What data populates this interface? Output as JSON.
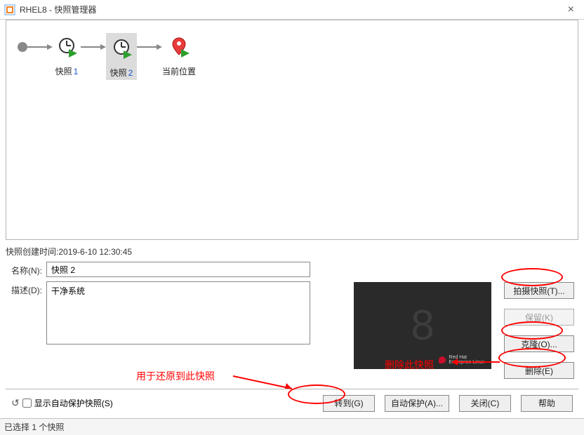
{
  "window": {
    "title": "RHEL8 - 快照管理器"
  },
  "tree": {
    "snap1_label": "快照",
    "snap1_num": "1",
    "snap2_label": "快照",
    "snap2_num": "2",
    "current_label": "当前位置"
  },
  "details": {
    "created_label": "快照创建时间:",
    "created_value": "2019-6-10 12:30:45",
    "name_label": "名称(N):",
    "name_value": "快照 2",
    "desc_label": "描述(D):",
    "desc_value": "干净系统"
  },
  "preview": {
    "glyph": "8",
    "brand_top": "Red Hat",
    "brand_bot": "Enterprise Linux"
  },
  "side": {
    "take": "拍摄快照(T)...",
    "keep": "保留(K)",
    "clone": "克隆(O)...",
    "delete": "删除(E)"
  },
  "bottom": {
    "show_auto": "显示自动保护快照(S)",
    "goto": "转到(G)",
    "autoprotect": "自动保护(A)...",
    "close": "关闭(C)",
    "help": "帮助"
  },
  "status": {
    "text": "已选择 1 个快照"
  },
  "annotations": {
    "restore_hint": "用于还原到此快照",
    "delete_hint": "删除此快照"
  }
}
